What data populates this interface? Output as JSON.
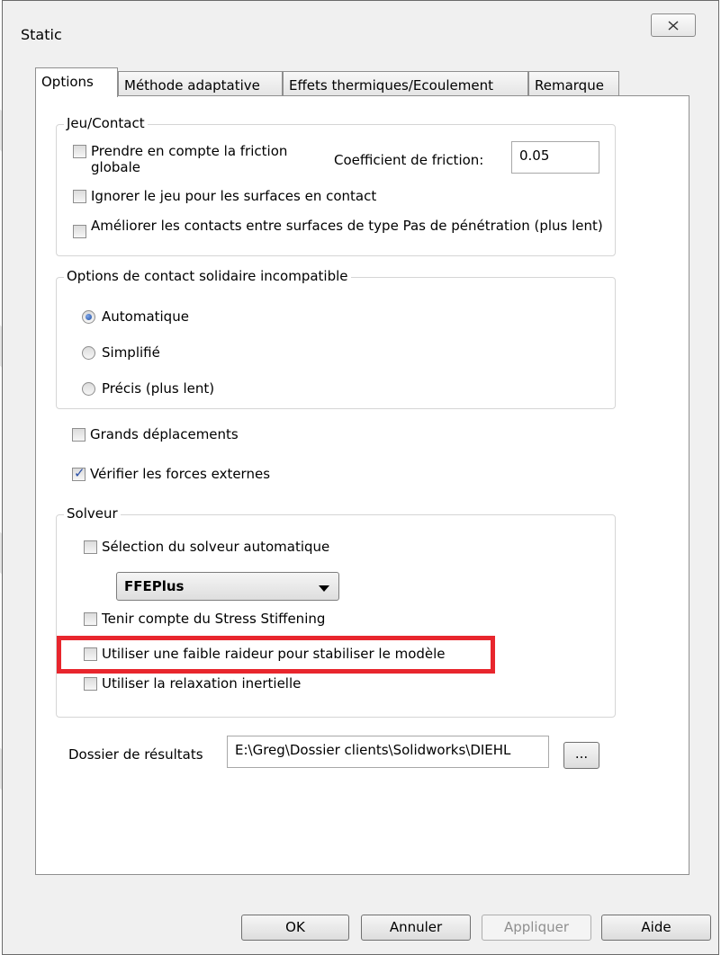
{
  "window": {
    "title": "Static"
  },
  "tabs": [
    {
      "label": "Options"
    },
    {
      "label": "Méthode adaptative"
    },
    {
      "label": "Effets thermiques/Ecoulement"
    },
    {
      "label": "Remarque"
    }
  ],
  "contact_group": {
    "title": "Jeu/Contact",
    "friction_label": "Prendre en compte la friction globale",
    "friction_checked": false,
    "coef_label": "Coefficient de friction:",
    "coef_value": "0.05",
    "ignore_gap_label": "Ignorer le jeu pour les surfaces en contact",
    "ignore_gap_checked": false,
    "improve_label": "Améliorer les contacts entre surfaces de type Pas de pénétration (plus lent)",
    "improve_checked": false
  },
  "bonded_group": {
    "title": "Options de contact solidaire incompatible",
    "options": [
      {
        "label": "Automatique",
        "selected": true
      },
      {
        "label": "Simplifié",
        "selected": false
      },
      {
        "label": "Précis (plus lent)",
        "selected": false
      }
    ]
  },
  "large_displacement": {
    "label": "Grands déplacements",
    "checked": false
  },
  "check_forces": {
    "label": "Vérifier les forces externes",
    "checked": true
  },
  "solver_group": {
    "title": "Solveur",
    "auto_label": "Sélection du solveur automatique",
    "auto_checked": false,
    "solver_value": "FFEPlus",
    "stress_label": "Tenir compte du Stress Stiffening",
    "stress_checked": false,
    "soft_spring_label": "Utiliser une faible raideur pour stabiliser le modèle",
    "soft_spring_checked": false,
    "inertial_label": "Utiliser la relaxation inertielle",
    "inertial_checked": false
  },
  "results": {
    "label": "Dossier de résultats",
    "path": "E:\\Greg\\Dossier clients\\Solidworks\\DIEHL",
    "browse_label": "..."
  },
  "buttons": {
    "ok": "OK",
    "cancel": "Annuler",
    "apply": "Appliquer",
    "help": "Aide"
  },
  "highlight_color": "#e8262d"
}
